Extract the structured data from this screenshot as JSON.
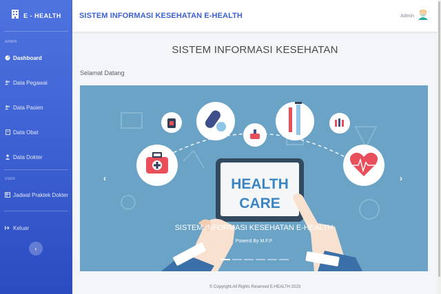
{
  "sidebar": {
    "brand": "E - HEALTH",
    "section_admin": "ADMIN",
    "section_user": "USER",
    "items": [
      {
        "label": "Dashboard"
      },
      {
        "label": "Data Pegawai"
      },
      {
        "label": "Data Pasien"
      },
      {
        "label": "Data Obat"
      },
      {
        "label": "Data Dokter"
      },
      {
        "label": "Jadwal Praktek Dokter"
      },
      {
        "label": "Keluar"
      }
    ],
    "toggle": "‹"
  },
  "header": {
    "title": "SISTEM INFORMASI KESEHATAN E-HEALTH",
    "user": "Admin"
  },
  "main": {
    "heading": "SISTEM INFORMASI KESEHATAN",
    "welcome": "Selamat Datang",
    "carousel": {
      "image_text_1": "HEALTH",
      "image_text_2": "CARE",
      "caption_title": "SISTEM INFORMASI KESEHATAN E-HEALTH",
      "caption_sub": "Powerd By M.F.P",
      "prev": "‹",
      "next": "›",
      "slide_count": 6,
      "active_slide": 1
    }
  },
  "footer": {
    "text": "© Copyright.All Rights Reserved E-HEALTH 2023"
  },
  "colors": {
    "sidebar": "#4e73df",
    "title": "#3b5fd1",
    "banner": "#6aa3c5"
  }
}
